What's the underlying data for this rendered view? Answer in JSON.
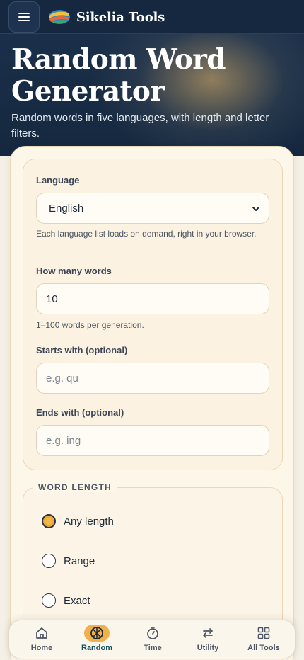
{
  "header": {
    "brand_name": "Sikelia Tools",
    "menu_icon": "hamburger-menu-icon",
    "logo_icon": "sikelia-logo"
  },
  "hero": {
    "title": "Random Word Generator",
    "subtitle": "Random words in five languages, with length and letter filters."
  },
  "form": {
    "language": {
      "label": "Language",
      "value": "English",
      "help": "Each language list loads on demand, right in your browser."
    },
    "count": {
      "label": "How many words",
      "value": "10",
      "help": "1–100 words per generation."
    },
    "starts_with": {
      "label": "Starts with (optional)",
      "placeholder": "e.g. qu"
    },
    "ends_with": {
      "label": "Ends with (optional)",
      "placeholder": "e.g. ing"
    }
  },
  "word_length": {
    "legend": "WORD LENGTH",
    "options": [
      {
        "label": "Any length",
        "checked": true
      },
      {
        "label": "Range",
        "checked": false
      },
      {
        "label": "Exact",
        "checked": false
      }
    ]
  },
  "bottom_nav": {
    "items": [
      {
        "label": "Home",
        "icon": "home-icon",
        "active": false
      },
      {
        "label": "Random",
        "icon": "random-icon",
        "active": true
      },
      {
        "label": "Time",
        "icon": "stopwatch-icon",
        "active": false
      },
      {
        "label": "Utility",
        "icon": "swap-arrows-icon",
        "active": false
      },
      {
        "label": "All Tools",
        "icon": "grid-icon",
        "active": false
      }
    ]
  },
  "colors": {
    "header_bg": "#15283f",
    "accent": "#f0b14a",
    "card_bg": "#fdf7ea",
    "active_nav_text": "#0f4f5e"
  }
}
